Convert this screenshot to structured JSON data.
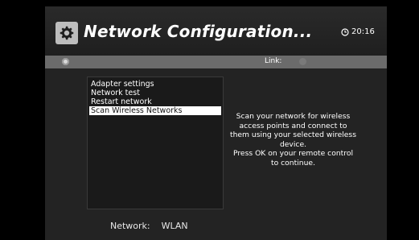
{
  "header": {
    "title": "Network Configuration...",
    "time": "20:16"
  },
  "status_bar": {
    "link_label": "Link:"
  },
  "menu": {
    "items": [
      {
        "label": "Adapter settings",
        "selected": false
      },
      {
        "label": "Network test",
        "selected": false
      },
      {
        "label": "Restart network",
        "selected": false
      },
      {
        "label": "Scan Wireless Networks",
        "selected": true
      }
    ]
  },
  "description": {
    "line1": "Scan your network for wireless",
    "line2": "access points and connect to",
    "line3": "them using your selected wireless",
    "line4": "device.",
    "line5": "Press OK on your remote control",
    "line6": "to continue."
  },
  "footer": {
    "network_label": "Network:",
    "network_value": "WLAN"
  },
  "colors": {
    "background": "#232323",
    "status_bar": "#6b6b6b",
    "selection": "#ffffff",
    "text": "#ffffff"
  },
  "icons": {
    "header": "gear-icon",
    "clock": "clock-icon"
  }
}
